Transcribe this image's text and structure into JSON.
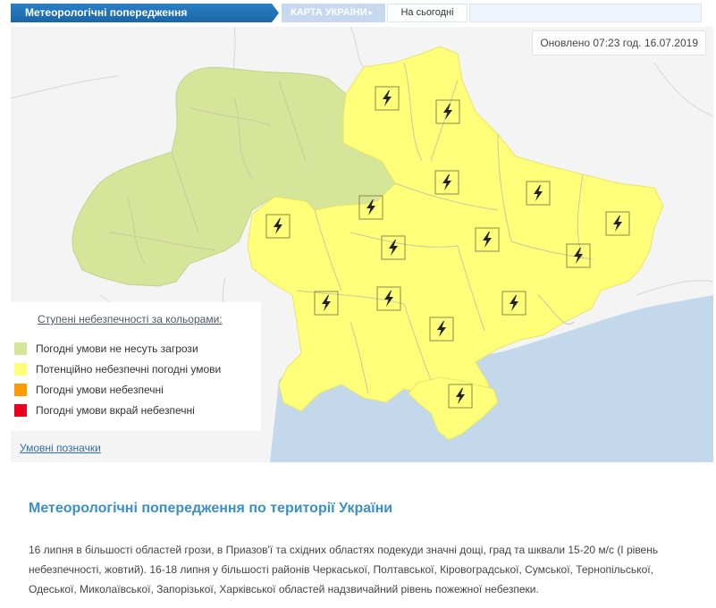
{
  "tabs": {
    "main_label": "Метеорологічні попередження",
    "map_label": "КАРТА УКРАЇНИ",
    "map_arrow": "▸",
    "today_label": "На сьогодні"
  },
  "map": {
    "updated_label": "Оновлено 07:23 год. 16.07.2019",
    "colors": {
      "safe": "#d5e59a",
      "potential": "#ffff7a",
      "dangerous": "#ff9a00",
      "extreme": "#e8001c",
      "sea": "#c3d8ea"
    },
    "warning_icon": "lightning-icon"
  },
  "legend": {
    "title": "Ступені небезпечності за кольорами:",
    "items": [
      {
        "label": "Погодні умови не несуть загрози",
        "color": "#d5e59a"
      },
      {
        "label": "Потенційно небезпечні погодні умови",
        "color": "#ffff7a"
      },
      {
        "label": "Погодні умови небезпечні",
        "color": "#ff9a00"
      },
      {
        "label": "Погодні умови вкрай небезпечні",
        "color": "#e8001c"
      }
    ],
    "link_label": "Умовні позначки"
  },
  "article": {
    "title": "Метеорологічні попередження по території України",
    "text": "16 липня в більшості областей грози, в Приазов'ї та східних областях подекуди значні дощі, град та шквали 15-20 м/с (I рівень небезпечності, жовтий). 16-18 липня у більшості районів Черкаської, Полтавської, Кіровоградської, Сумської, Тернопільської, Одеської, Миколаївської, Запорізької, Харківської областей надзвичайний рівень пожежної небезпеки."
  }
}
